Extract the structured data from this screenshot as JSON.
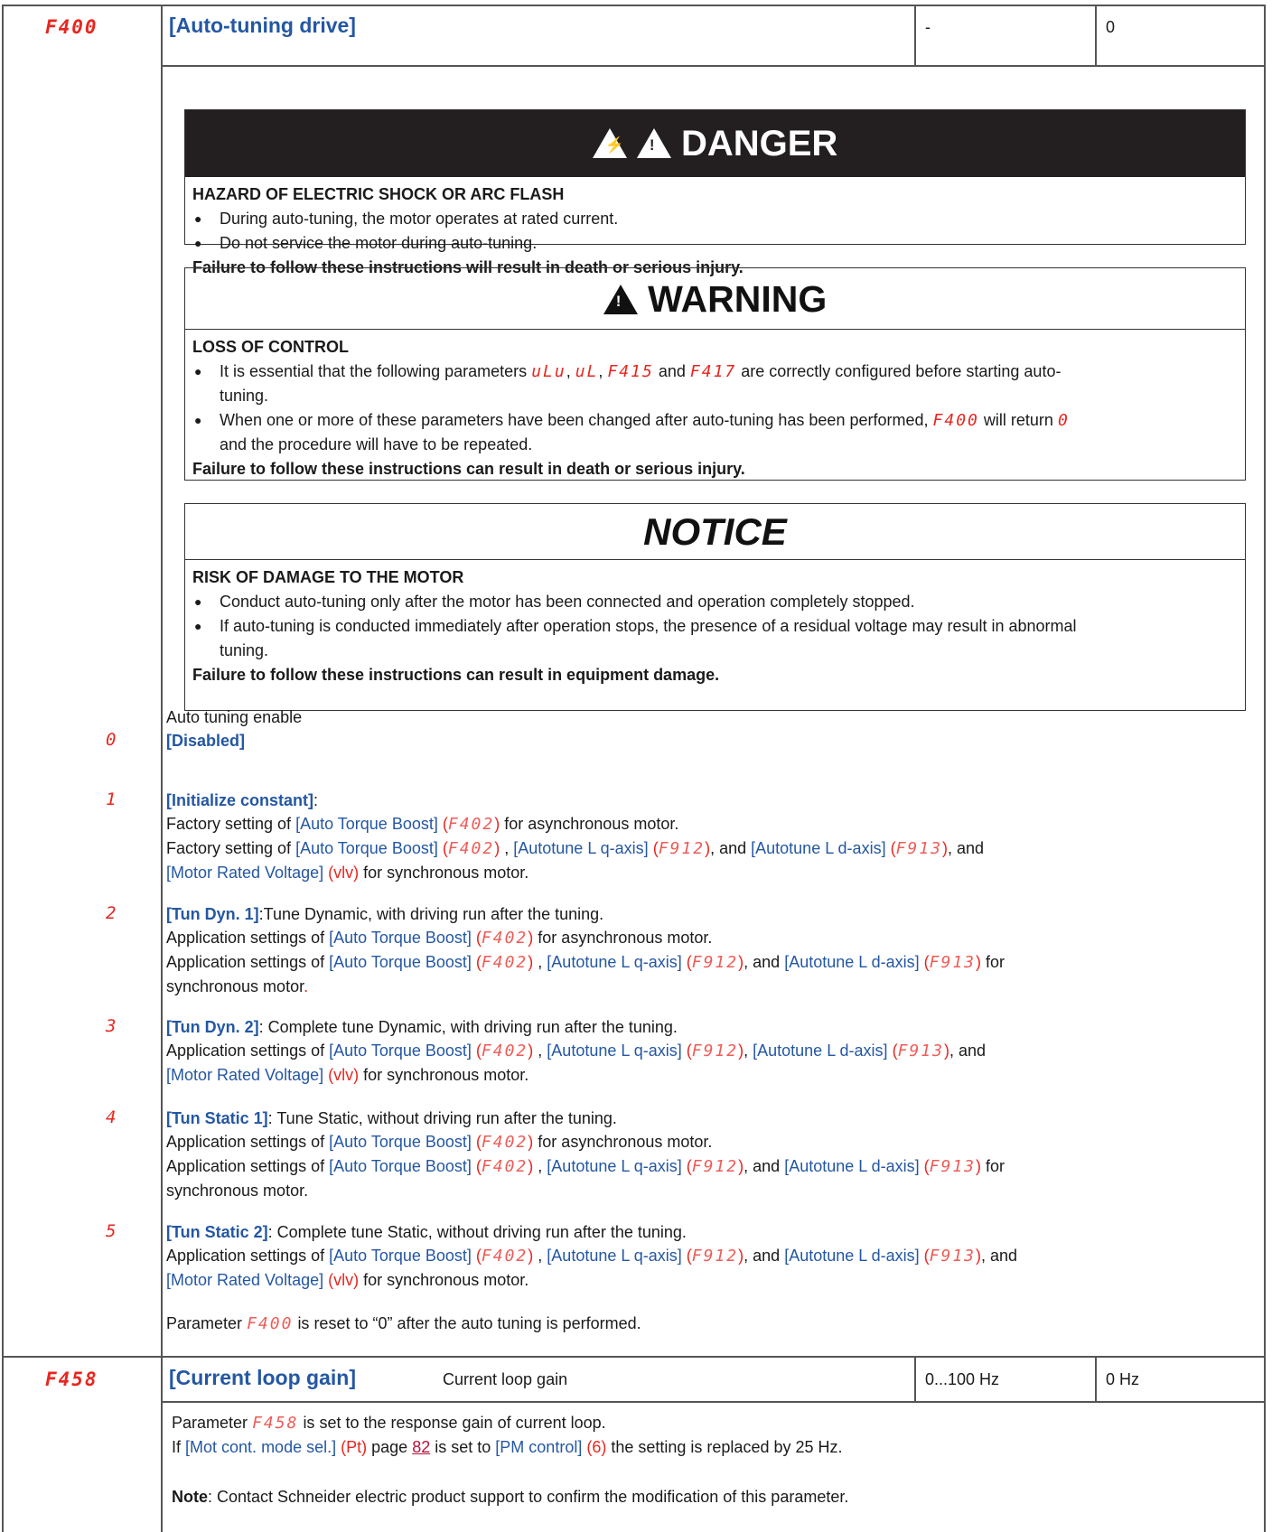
{
  "row1": {
    "code": "F400",
    "title": "[Auto-tuning drive]",
    "range": "-",
    "default": "0"
  },
  "danger": {
    "heading": "DANGER",
    "subtitle": "HAZARD OF ELECTRIC SHOCK OR ARC FLASH",
    "bullets": [
      "During auto-tuning, the motor operates at rated current.",
      "Do not service the motor during auto-tuning."
    ],
    "footer": "Failure to follow these instructions will result in death or serious injury."
  },
  "warning": {
    "heading": "WARNING",
    "subtitle": "LOSS OF CONTROL",
    "b1_pre": "It is essential that the following parameters",
    "b1_c1": "uLu",
    "b1_sep1": ",",
    "b1_c2": "uL",
    "b1_sep2": ",",
    "b1_c3": "F415",
    "b1_and": "and",
    "b1_c4": "F417",
    "b1_post": "are correctly configured before starting auto-",
    "b1_line2": "tuning.",
    "b2_pre": "When one or more of these parameters have been changed after auto-tuning has been performed,",
    "b2_c1": "F400",
    "b2_mid": "will return",
    "b2_c2": "0",
    "b2_line2": "and the procedure will have to be repeated.",
    "footer": "Failure to follow these instructions can result in death or serious injury."
  },
  "notice": {
    "heading": "NOTICE",
    "subtitle": "RISK OF DAMAGE TO THE MOTOR",
    "bullet1": "Conduct auto-tuning only after the motor has been connected and operation completely stopped.",
    "bullet2_line1": "If auto-tuning is conducted immediately after operation stops, the presence of a residual voltage may result in abnormal",
    "bullet2_line2": "tuning.",
    "footer": "Failure to follow these instructions can result in equipment damage."
  },
  "values": {
    "intro": "Auto tuning enable",
    "v0": {
      "code": "0",
      "label": "[Disabled]"
    },
    "v1": {
      "code": "1",
      "label": "[Initialize constant]",
      "colon": ":",
      "l1_pre": "Factory setting of",
      "atb": "[Auto Torque Boost]",
      "f402": "F402",
      "l1_post": "for asynchronous motor.",
      "l2_pre": "Factory setting of",
      "altq": "[Autotune L q-axis]",
      "f912": "F912",
      "altd": "[Autotune L d-axis]",
      "f913": "F913",
      "and": "and",
      "mrv": "[Motor Rated Voltage]",
      "vlv": "vlv",
      "l3_post": "for synchronous motor."
    },
    "v2": {
      "code": "2",
      "label": "[Tun Dyn. 1]",
      "desc": ":Tune Dynamic, with driving run after the tuning.",
      "l1_pre": "Application settings of",
      "l1_post": "for asynchronous motor.",
      "l2_pre": "Application settings of",
      "l2_post": "for",
      "l3": "synchronous motor",
      "dot": "."
    },
    "v3": {
      "code": "3",
      "label": "[Tun Dyn. 2]",
      "desc": ": Complete tune Dynamic, with driving run after the tuning.",
      "l1_pre": "Application settings of",
      "l2_post": "for synchronous motor."
    },
    "v4": {
      "code": "4",
      "label": "[Tun Static 1]",
      "desc": ": Tune Static, without driving run after the tuning.",
      "l1_pre": "Application settings of",
      "l1_post": "for asynchronous motor.",
      "l2_pre": "Application settings of",
      "l2_post": "for",
      "l3": "synchronous motor."
    },
    "v5": {
      "code": "5",
      "label": "[Tun Static 2]",
      "desc": ": Complete tune Static, without driving run after the tuning.",
      "l1_pre": "Application settings of",
      "l2_post": "for synchronous motor."
    },
    "reset_pre": "Parameter",
    "reset_code": "F400",
    "reset_post": "is reset to “0” after the auto tuning is performed."
  },
  "row2": {
    "code": "F458",
    "title": "[Current loop gain]",
    "subtitle": "Current loop gain",
    "range": "0...100 Hz",
    "default": "0 Hz",
    "p1_pre": "Parameter",
    "p1_code": "F458",
    "p1_post": "is set to the response gain of current loop.",
    "p2_pre": "If",
    "p2_mode": "[Mot cont. mode sel.]",
    "p2_pt": "(Pt)",
    "p2_page": "page",
    "p2_link": "82",
    "p2_mid": "is set to",
    "p2_pm": "[PM control]",
    "p2_six": "(6)",
    "p2_post": "the setting is replaced by 25 Hz.",
    "note_label": "Note",
    "note_text": ": Contact Schneider electric product support to confirm the modification of this parameter."
  }
}
